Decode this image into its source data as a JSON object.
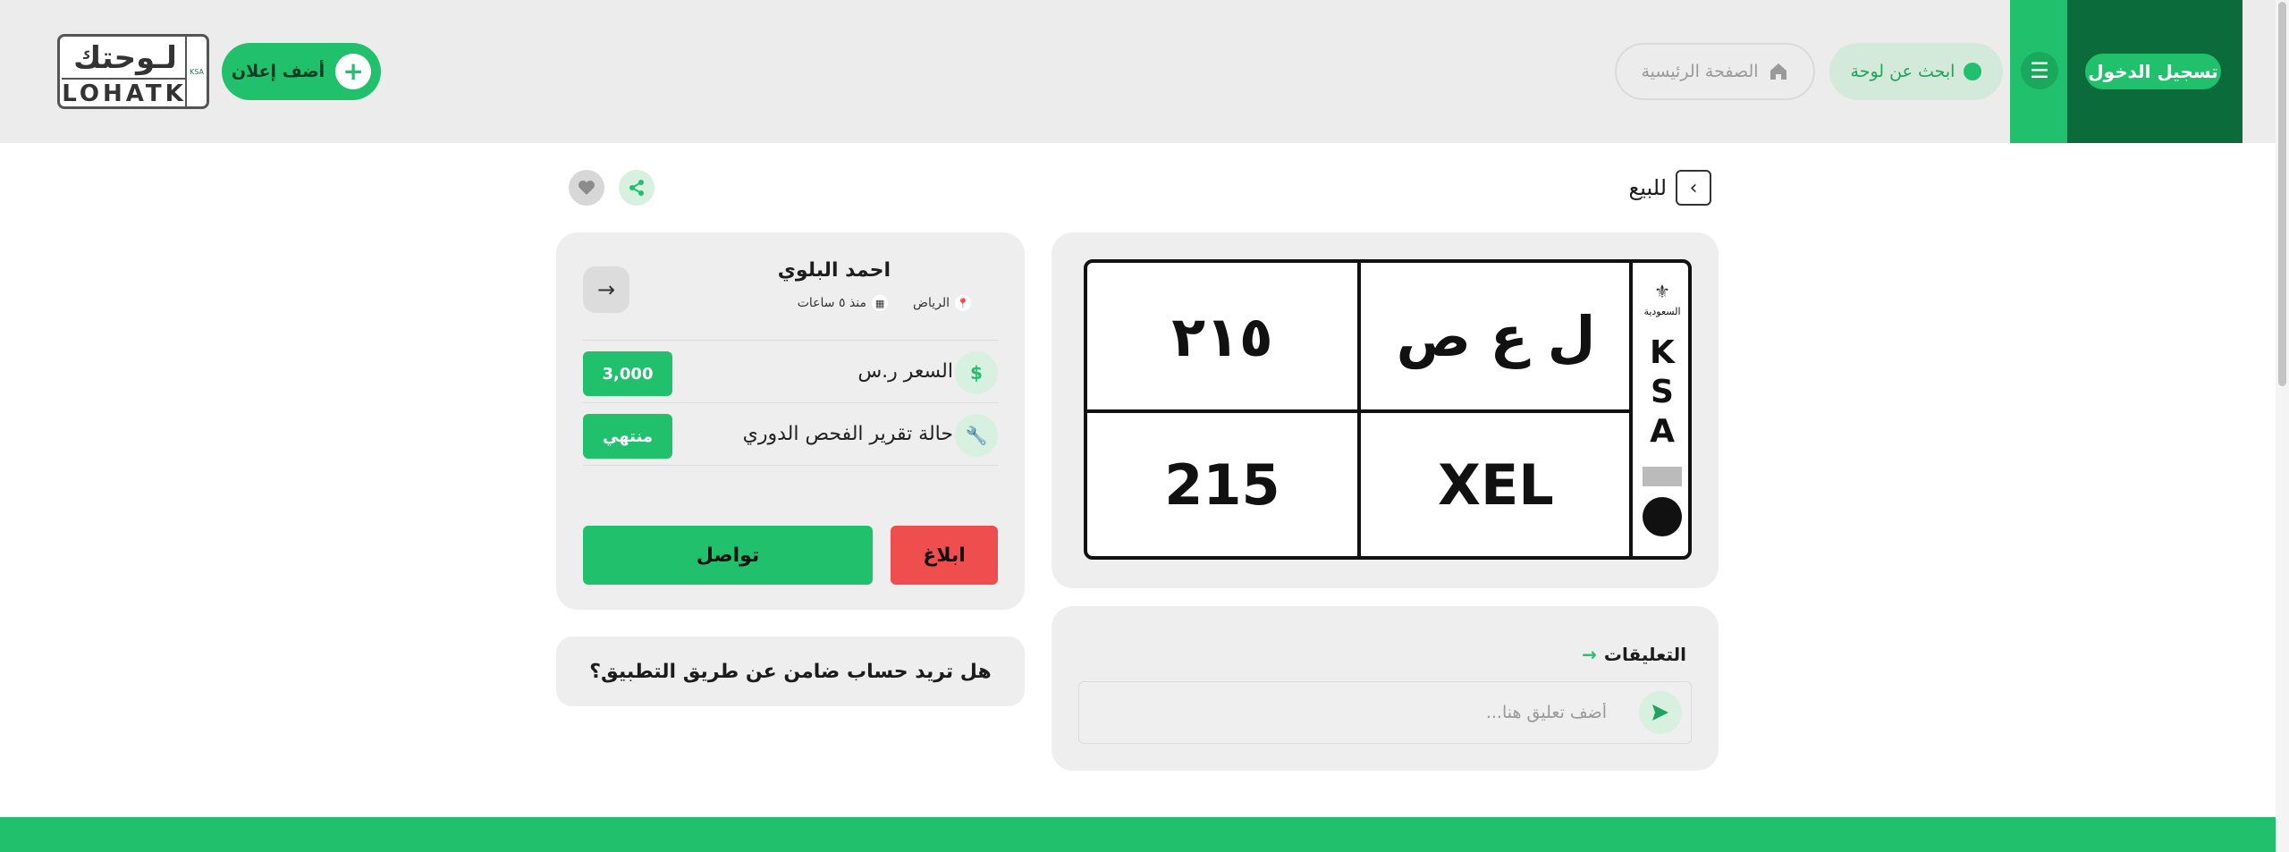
{
  "header": {
    "login_label": "تسجيل الدخول",
    "search_label": "ابحث عن لوحة",
    "home_label": "الصفحة الرئيسية",
    "add_ad_label": "أضف إعلان",
    "logo_ar": "لـوحتك",
    "logo_en": "LOHATK",
    "logo_strip": "KSA"
  },
  "title": "للبيع",
  "plate": {
    "arabic_letters": "ل ع ص",
    "arabic_numbers": "٢١٥",
    "latin_letters": "XEL",
    "latin_numbers": "215",
    "country": "السعودية",
    "side_letters": [
      "K",
      "S",
      "A"
    ]
  },
  "seller": {
    "name": "احمد البلوي",
    "city": "الرياض",
    "time": "منذ ٥ ساعات",
    "price_label": "السعر ر.س",
    "price_value": "3,000",
    "inspection_label": "حالة تقرير الفحص الدوري",
    "inspection_value": "منتهي",
    "report_label": "ابلاغ",
    "contact_label": "تواصل"
  },
  "guarantee_text": "هل تريد حساب ضامن عن طريق التطبيق؟",
  "comments": {
    "title": "التعليقات",
    "placeholder": "أضف تعليق هنا..."
  },
  "colors": {
    "brand_green": "#21c06c",
    "dark_green": "#0b6b3a",
    "danger_red": "#ef4e4e"
  }
}
